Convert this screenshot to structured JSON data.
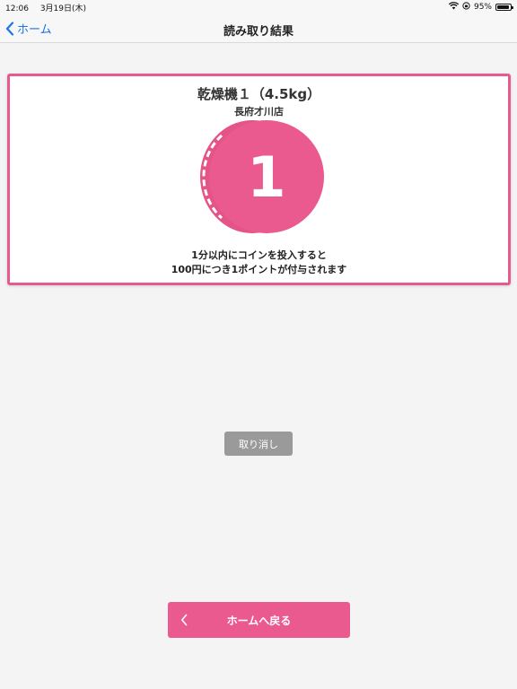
{
  "status_bar": {
    "time": "12:06",
    "date": "3月19日(木)",
    "battery_text": "95%",
    "battery_level": 0.95
  },
  "nav": {
    "back_label": "ホーム",
    "title": "読み取り結果"
  },
  "result": {
    "machine_name": "乾燥機１（4.5kg）",
    "store_name": "長府才川店",
    "coin_number": "1",
    "message_line1": "1分以内にコインを投入すると",
    "message_line2": "100円につき1ポイントが付与されます"
  },
  "actions": {
    "cancel_label": "取り消し",
    "home_label": "ホームへ戻る"
  },
  "colors": {
    "accent": "#e85a8f",
    "link": "#1a73e8",
    "cancel": "#9a9a9a",
    "background": "#f4f4f4"
  },
  "icons": {
    "back": "chevron-left-icon",
    "coin": "coin-icon",
    "wifi": "wifi-icon",
    "rotation_lock": "rotation-lock-icon",
    "battery": "battery-icon"
  }
}
